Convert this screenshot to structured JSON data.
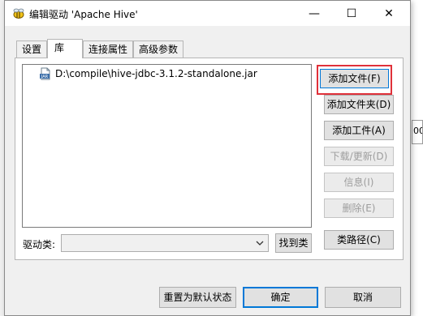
{
  "background": {
    "right_fragment": "00"
  },
  "window": {
    "title": "编辑驱动 'Apache Hive'",
    "minimize_glyph": "—",
    "maximize_glyph": "☐",
    "close_glyph": "✕"
  },
  "tabs": [
    {
      "label": "设置"
    },
    {
      "label": "库"
    },
    {
      "label": "连接属性"
    },
    {
      "label": "高级参数"
    }
  ],
  "library": {
    "files": [
      {
        "path": "D:\\compile\\hive-jdbc-3.1.2-standalone.jar",
        "icon": "jar-file-icon"
      }
    ],
    "buttons": {
      "add_file": "添加文件(F)",
      "add_folder": "添加文件夹(D)",
      "add_artifact": "添加工件(A)",
      "download_update": "下载/更新(D)",
      "info": "信息(I)",
      "delete": "删除(E)",
      "class_path": "类路径(C)"
    },
    "driver_class_label": "驱动类:",
    "driver_class_value": "",
    "find_class": "找到类"
  },
  "footer": {
    "reset_default": "重置为默认状态",
    "ok": "确定",
    "cancel": "取消"
  },
  "colors": {
    "highlight": "#e0313a",
    "focus_border": "#0078d7",
    "disabled_text": "#9d9d9d"
  }
}
